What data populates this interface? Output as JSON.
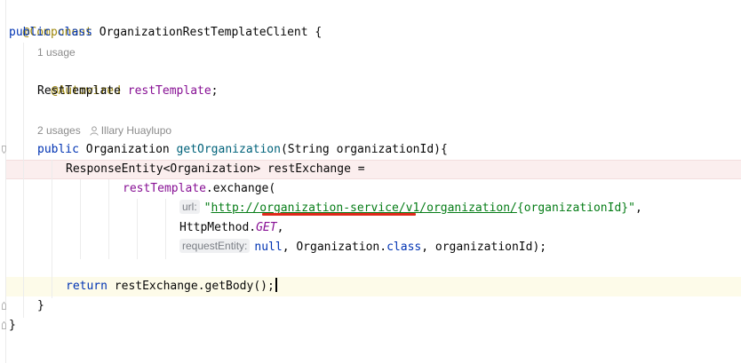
{
  "editor": {
    "line1": {
      "annotation": "@Component"
    },
    "line2": {
      "kw_public": "public",
      "kw_class": "class",
      "class_name": "OrganizationRestTemplateClient",
      "brace": "{"
    },
    "usage1": "1 usage",
    "line3": {
      "annotation": "@Autowired"
    },
    "line4": {
      "type": "RestTemplate",
      "field": "restTemplate",
      "end": ";"
    },
    "usage2": {
      "usages": "2 usages",
      "author": "Illary Huaylupo"
    },
    "line5": {
      "kw_public": "public",
      "type": "Organization",
      "method": "getOrganization",
      "params_open": "(String organizationId){"
    },
    "line6": {
      "text": "ResponseEntity<Organization> restExchange ="
    },
    "line7": {
      "field": "restTemplate",
      "rest": ".exchange("
    },
    "line8": {
      "hint": "url:",
      "quote_open": "\"",
      "url": "http://organization-service/v1/organization/",
      "tail": "{organizationId}\"",
      "comma": ","
    },
    "line9": {
      "prefix": "HttpMethod.",
      "static": "GET",
      "comma": ","
    },
    "line10": {
      "hint": "requestEntity:",
      "kw_null": "null",
      "mid": ", Organization.",
      "kw_class": "class",
      "tail": ", organizationId);"
    },
    "line11": {
      "kw_return": "return",
      "rest": " restExchange.getBody();"
    },
    "line12": {
      "brace": "}"
    },
    "line13": {
      "brace": "}"
    }
  },
  "colors": {
    "annotation": "#9e880d",
    "keyword": "#0033b3",
    "field": "#871094",
    "method": "#00627a",
    "string": "#067d17",
    "error_underline": "#e0281b",
    "highlight_error_line": "#fbeeee",
    "highlight_caret_line": "#fdfbe9"
  },
  "icons": [
    "fold-marker-icon",
    "author-person-icon",
    "text-caret"
  ]
}
